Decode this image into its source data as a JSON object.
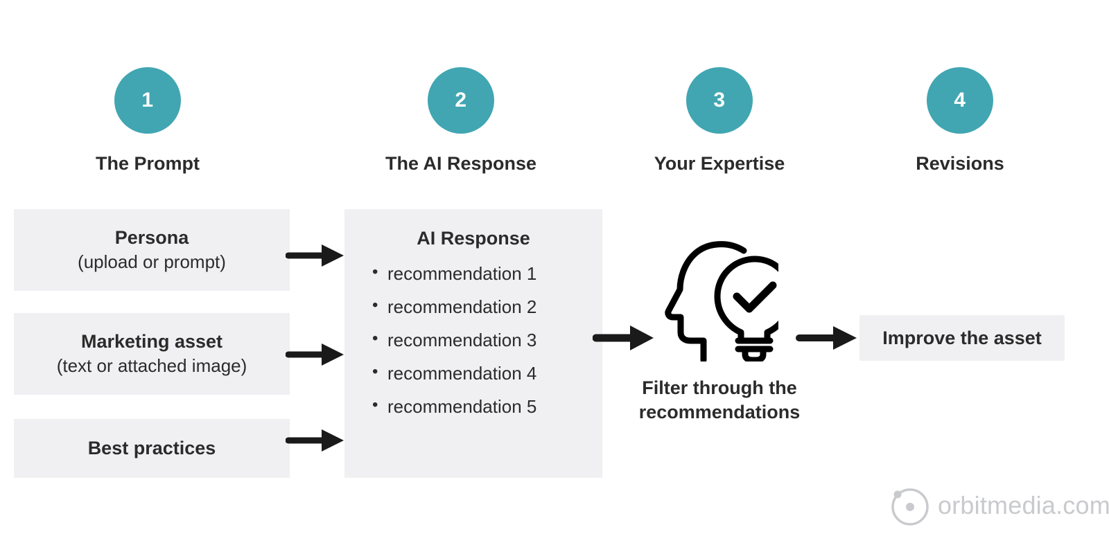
{
  "theme": {
    "accent": "#41a6b2",
    "box_bg": "#f0f0f2",
    "text": "#2b2b2b",
    "arrow": "#1a1a1a",
    "logo_gray": "#c9cacd",
    "page_bg": "#ffffff"
  },
  "steps": [
    {
      "number": "1",
      "label": "The Prompt"
    },
    {
      "number": "2",
      "label": "The AI Response"
    },
    {
      "number": "3",
      "label": "Your Expertise"
    },
    {
      "number": "4",
      "label": "Revisions"
    }
  ],
  "prompt_inputs": [
    {
      "title": "Persona",
      "sub": "(upload or prompt)"
    },
    {
      "title": "Marketing asset",
      "sub": "(text or attached image)"
    },
    {
      "title": "Best practices",
      "sub": ""
    }
  ],
  "ai_response": {
    "title": "AI Response",
    "recommendations": [
      "recommendation 1",
      "recommendation 2",
      "recommendation 3",
      "recommendation 4",
      "recommendation 5"
    ]
  },
  "expertise": {
    "icon": "head-with-lightbulb-check-icon",
    "caption_line1": "Filter through the",
    "caption_line2": "recommendations"
  },
  "outcome": {
    "label": "Improve the asset"
  },
  "arrows": [
    {
      "name": "arrow-persona-to-ai"
    },
    {
      "name": "arrow-marketing-asset-to-ai"
    },
    {
      "name": "arrow-best-practices-to-ai"
    },
    {
      "name": "arrow-ai-to-expertise"
    },
    {
      "name": "arrow-expertise-to-outcome"
    }
  ],
  "logo": {
    "text": "orbitmedia.com",
    "mark": "orbit-icon"
  }
}
